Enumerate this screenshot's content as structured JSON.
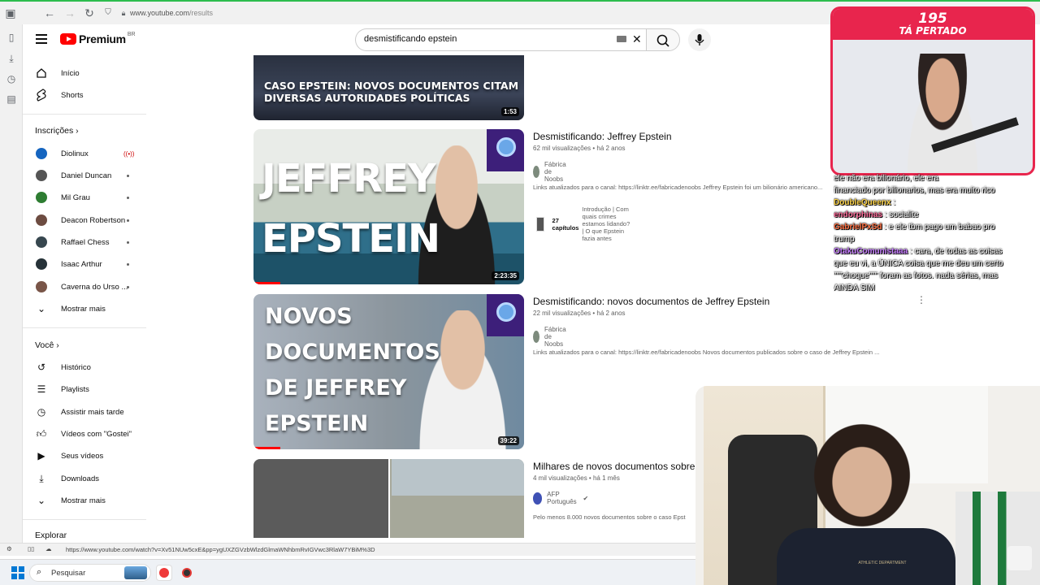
{
  "browser": {
    "url_host": "www.youtube.com",
    "url_path": "/results",
    "status_url": "https://www.youtube.com/watch?v=Xv51NUw5cxE&pp=ygUXZGVzbWlzdGlmaWNhbmRvIGVwc3RlaW7YBiM%3D"
  },
  "header": {
    "brand": "Premium",
    "country": "BR",
    "search_value": "desmistificando epstein"
  },
  "sidebar": {
    "main": [
      {
        "label": "Início",
        "icon": "home-icon"
      },
      {
        "label": "Shorts",
        "icon": "shorts-icon"
      }
    ],
    "subs_title": "Inscrições",
    "subs": [
      {
        "label": "Diolinux",
        "color": "#1565c0",
        "status": "live"
      },
      {
        "label": "Daniel Duncan",
        "color": "#555555",
        "status": "dot"
      },
      {
        "label": "Mil Grau",
        "color": "#2e7d32",
        "status": "dot"
      },
      {
        "label": "Deacon Robertson",
        "color": "#6d4c41",
        "status": "dot"
      },
      {
        "label": "Raffael Chess",
        "color": "#37474f",
        "status": "dot"
      },
      {
        "label": "Isaac Arthur",
        "color": "#263238",
        "status": "dot"
      },
      {
        "label": "Caverna do Urso ...",
        "color": "#795548",
        "status": "dot"
      }
    ],
    "subs_more": "Mostrar mais",
    "you_title": "Você",
    "you": [
      {
        "label": "Histórico",
        "icon": "history-icon"
      },
      {
        "label": "Playlists",
        "icon": "playlists-icon"
      },
      {
        "label": "Assistir mais tarde",
        "icon": "watch-later-icon"
      },
      {
        "label": "Vídeos com \"Gostei\"",
        "icon": "like-icon"
      },
      {
        "label": "Seus vídeos",
        "icon": "your-videos-icon"
      },
      {
        "label": "Downloads",
        "icon": "download-icon"
      }
    ],
    "you_more": "Mostrar mais",
    "explore_title": "Explorar"
  },
  "results": [
    {
      "thumb_text": "CASO EPSTEIN: NOVOS DOCUMENTOS CITAM DIVERSAS AUTORIDADES POLÍTICAS",
      "duration": "1:53"
    },
    {
      "title": "Desmistificando: Jeffrey Epstein",
      "views": "62 mil visualizações",
      "age": "há 2 anos",
      "channel": "Fábrica de Noobs",
      "desc": "Links atualizados para o canal: https://linktr.ee/fabricadenoobs Jeffrey Epstein foi um bilionário americano...",
      "chapters_count": "27 capítulos",
      "chapters_text": "Introdução | Com quais crimes estamos lidando? | O que Epstein fazia antes",
      "thumb_line1": "JEFFREY",
      "thumb_line2": "EPSTEIN",
      "duration": "2:23:35",
      "progress": 0.1
    },
    {
      "title": "Desmistificando: novos documentos de Jeffrey Epstein",
      "views": "22 mil visualizações",
      "age": "há 2 anos",
      "channel": "Fábrica de Noobs",
      "desc": "Links atualizados para o canal: https://linktr.ee/fabricadenoobs Novos documentos publicados sobre o caso de Jeffrey Epstein ...",
      "thumb_line1": "NOVOS",
      "thumb_line2": "DOCUMENTOS",
      "thumb_line3": "DE JEFFREY",
      "thumb_line4": "EPSTEIN",
      "duration": "39:22",
      "progress": 0.1
    },
    {
      "title": "Milhares de novos documentos sobre",
      "views": "4 mil visualizações",
      "age": "há 1 mês",
      "channel": "AFP Português",
      "desc": "Pelo menos 8.000 novos documentos sobre o caso Epst"
    }
  ],
  "stream": {
    "counter": "195",
    "banner": "TÁ PERTADO",
    "chat": [
      {
        "user": "",
        "text": "ele não era bilionário, ele era"
      },
      {
        "user": "",
        "text": "financiado por bilionarios, mas era muito rico"
      },
      {
        "user": "DoubleQueenx",
        "text": ":"
      },
      {
        "user": "endorphinas",
        "text": ": socialite"
      },
      {
        "user": "GabrielPxSd",
        "text": ": e ele tbm pago um babao pro"
      },
      {
        "user": "",
        "text": "trump"
      },
      {
        "user": "OtakuComunistaaa",
        "text": ": cara, de todas as coisas"
      },
      {
        "user": "",
        "text": "que eu vi, a ÚNICA coisa que me deu um certo"
      },
      {
        "user": "",
        "text": "\"\"\"choque\"\"\" foram as fotos. nada sérias, mas"
      },
      {
        "user": "",
        "text": "AINDA SIM"
      }
    ],
    "jersey_text": "ATHLETIC DEPARTMENT"
  },
  "taskbar": {
    "search_label": "Pesquisar"
  }
}
